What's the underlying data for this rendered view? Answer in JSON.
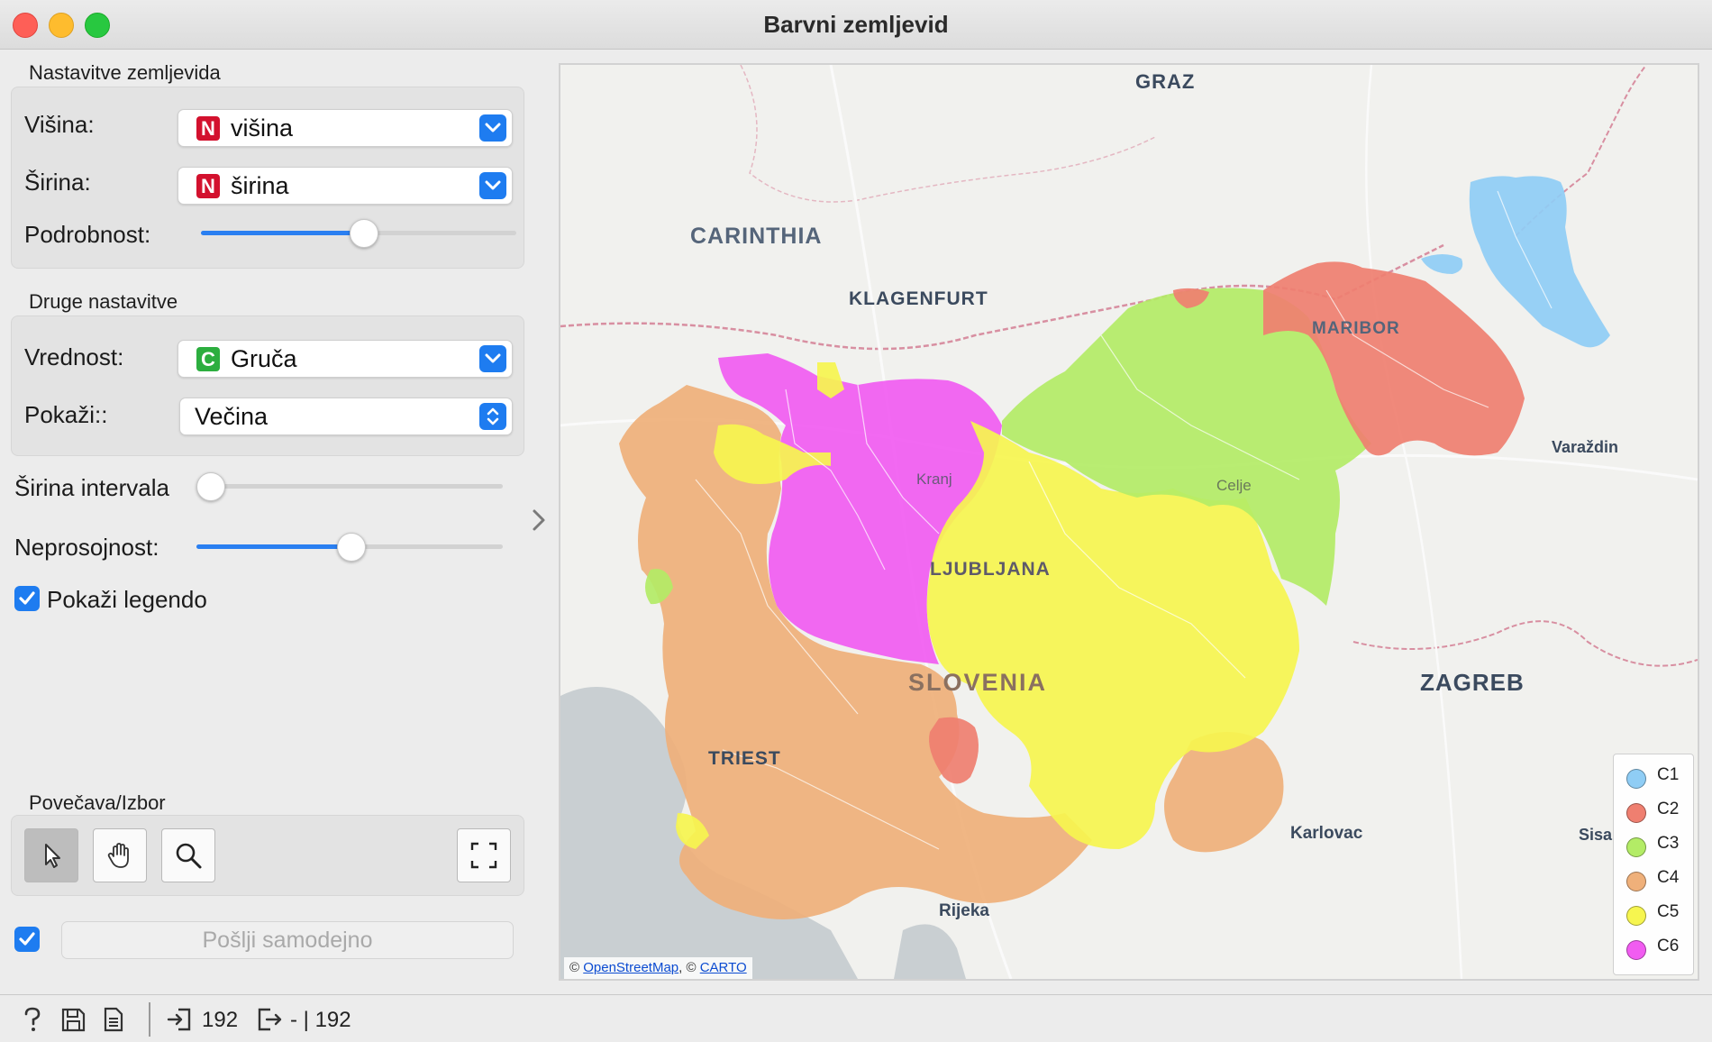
{
  "window": {
    "title": "Barvni zemljevid"
  },
  "map_settings": {
    "section_title": "Nastavitve zemljevida",
    "latitude_label": "Višina:",
    "latitude_value": "višina",
    "latitude_type": "N",
    "longitude_label": "Širina:",
    "longitude_value": "širina",
    "longitude_type": "N",
    "detail_label": "Podrobnost:",
    "detail_level": 0.5
  },
  "other_settings": {
    "section_title": "Druge nastavitve",
    "value_label": "Vrednost:",
    "value_value": "Gruča",
    "value_type": "C",
    "show_label": "Pokaži::",
    "show_value": "Večina",
    "bin_width_label": "Širina intervala",
    "bin_width_level": 0.0,
    "opacity_label": "Neprosojnost:",
    "opacity_level": 0.5,
    "legend_label": "Pokaži legendo",
    "legend_checked": true
  },
  "zoom_select": {
    "section_title": "Povečava/Izbor",
    "tools": [
      "select-pointer-icon",
      "pan-hand-icon",
      "zoom-magnifier-icon",
      "fit-screen-icon"
    ]
  },
  "send": {
    "label": "Pošlji samodejno",
    "checked": true
  },
  "map": {
    "labels": {
      "graz": "GRAZ",
      "carinthia": "CARINTHIA",
      "klagenfurt": "KLAGENFURT",
      "maribor": "MARIBOR",
      "varazdin": "Varaždin",
      "kranj": "Kranj",
      "celje": "Celje",
      "ljubljana": "LJUBLJANA",
      "slovenia": "SLOVENIA",
      "zagreb": "ZAGREB",
      "triest": "TRIEST",
      "karlovac": "Karlovac",
      "sisak": "Sisa",
      "rijeka": "Rijeka"
    },
    "attribution": {
      "prefix": "©",
      "osm": "OpenStreetMap",
      "sep": ", ©",
      "carto": "CARTO"
    },
    "legend": [
      {
        "label": "C1",
        "color": "#8fcdf5"
      },
      {
        "label": "C2",
        "color": "#ef7f70"
      },
      {
        "label": "C3",
        "color": "#b3ec66"
      },
      {
        "label": "C4",
        "color": "#efb07a"
      },
      {
        "label": "C5",
        "color": "#f6f54f"
      },
      {
        "label": "C6",
        "color": "#f15cf1"
      }
    ]
  },
  "statusbar": {
    "icons": [
      "help-icon",
      "save-icon",
      "report-icon"
    ],
    "input_count": "192",
    "output_count": "- | 192"
  }
}
